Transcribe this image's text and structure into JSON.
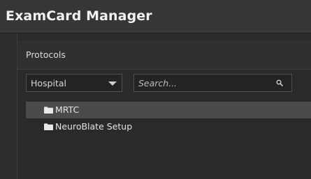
{
  "window": {
    "title": "ExamCard Manager"
  },
  "panel": {
    "section_title": "Protocols",
    "source_dropdown": {
      "selected": "Hospital",
      "icon": "triangle-down-icon"
    },
    "search": {
      "placeholder": "Search...",
      "value": "",
      "icon": "search-icon"
    },
    "tree": {
      "items": [
        {
          "label": "MRTC",
          "icon": "folder-icon",
          "selected": true
        },
        {
          "label": "NeuroBlate Setup",
          "icon": "folder-icon",
          "selected": false
        }
      ]
    }
  },
  "colors": {
    "background": "#2e2e2e",
    "titlebar": "#363636",
    "selected_row": "#4b4b4b",
    "text": "#e4e4e4"
  }
}
